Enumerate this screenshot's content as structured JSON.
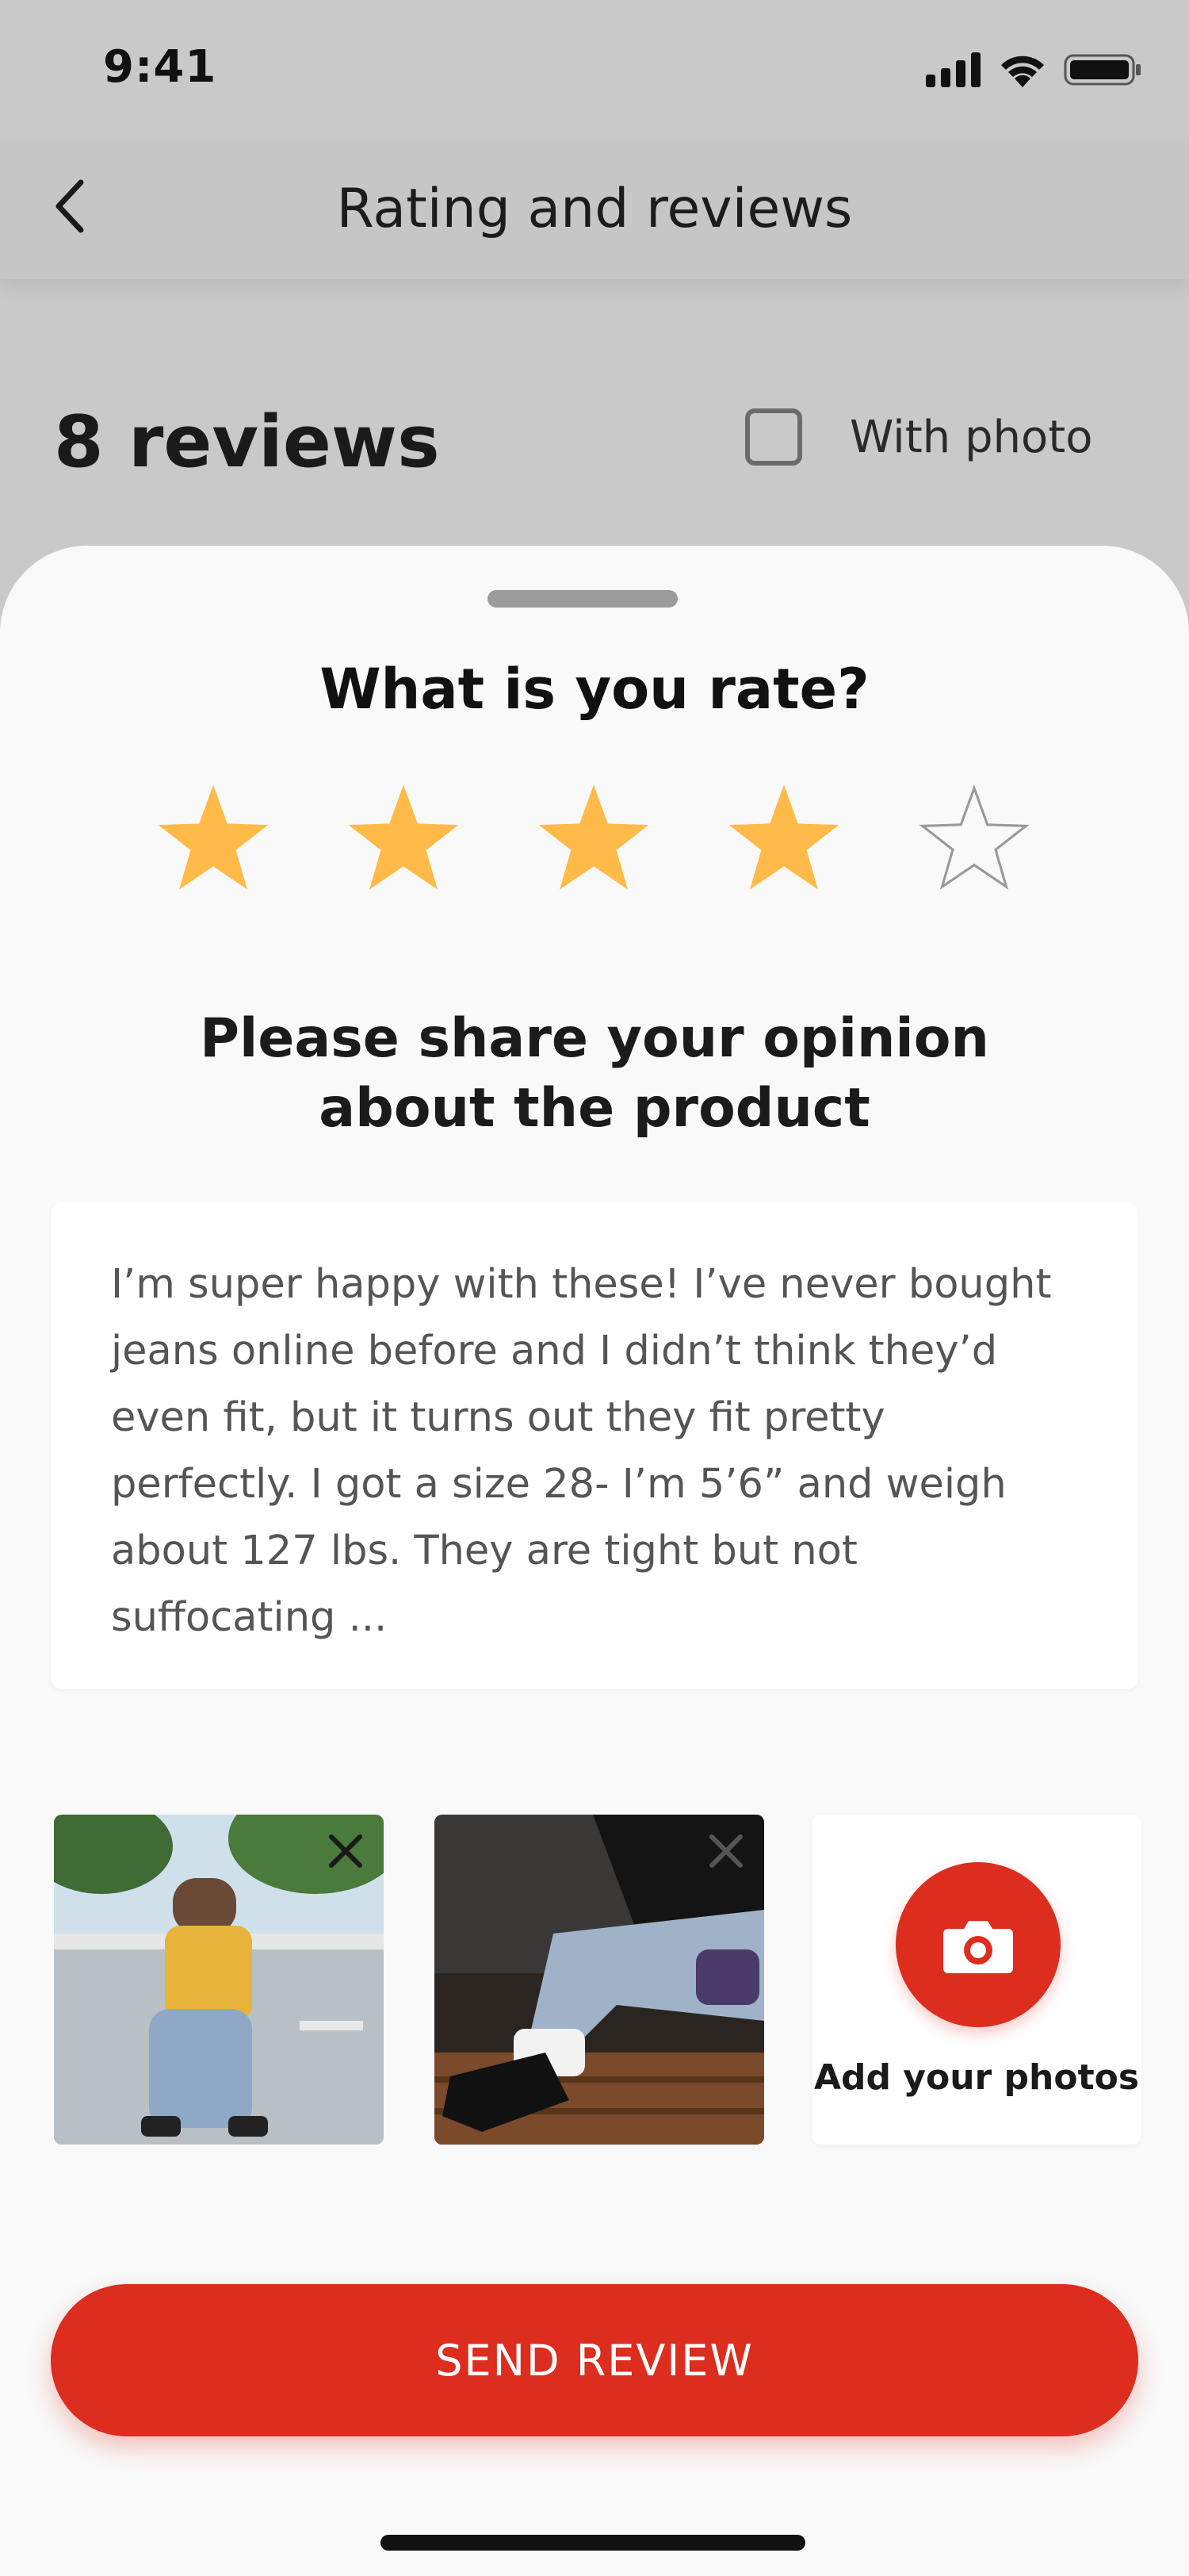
{
  "status_bar": {
    "time": "9:41"
  },
  "header": {
    "title": "Rating and reviews",
    "back_icon": "chevron-left-icon"
  },
  "filters": {
    "reviews_count": "8 reviews",
    "with_photo_label": "With photo",
    "with_photo_checked": false
  },
  "sheet": {
    "title": "What is you rate?",
    "rating": 4,
    "max_rating": 5,
    "star_color": "#ffba49",
    "prompt_line1": "Please share your opinion",
    "prompt_line2": "about the product",
    "review_text": "I’m super happy with these! I’ve never bought jeans online before and I didn’t think they’d even fit, but it turns out they fit pretty perfectly. I got a size 28- I’m 5’6” and weigh about 127 lbs. They are tight but not suffocating ...",
    "add_photos_label": "Add your photos",
    "send_button_label": "SEND REVIEW"
  },
  "colors": {
    "accent": "#dc2d1f",
    "sheet_bg": "#f9f9f9",
    "dim_bg": "#c9c9c9"
  }
}
